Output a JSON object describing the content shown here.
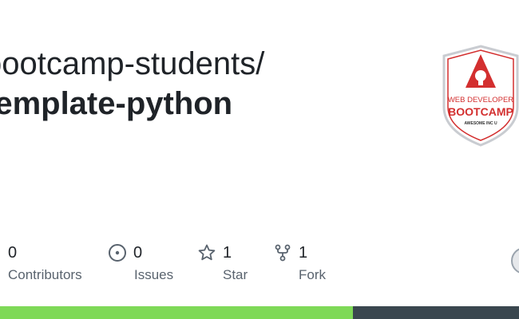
{
  "repo": {
    "owner_line": "bootcamp-students/",
    "name_line": "template-python"
  },
  "logo": {
    "line1": "WEB DEVELOPER",
    "line2": "BOOTCAMP",
    "line3": "AWESOME INC U",
    "red": "#d32f2f"
  },
  "stats": [
    {
      "icon": "people-icon",
      "count": "0",
      "label": "Contributors"
    },
    {
      "icon": "issue-circle-icon",
      "count": "0",
      "label": "Issues"
    },
    {
      "icon": "star-icon",
      "count": "1",
      "label": "Star"
    },
    {
      "icon": "fork-icon",
      "count": "1",
      "label": "Fork"
    }
  ],
  "language_bar": [
    {
      "color": "#7ed957",
      "fraction": 0.68
    },
    {
      "color": "#3a474f",
      "fraction": 0.32
    }
  ]
}
